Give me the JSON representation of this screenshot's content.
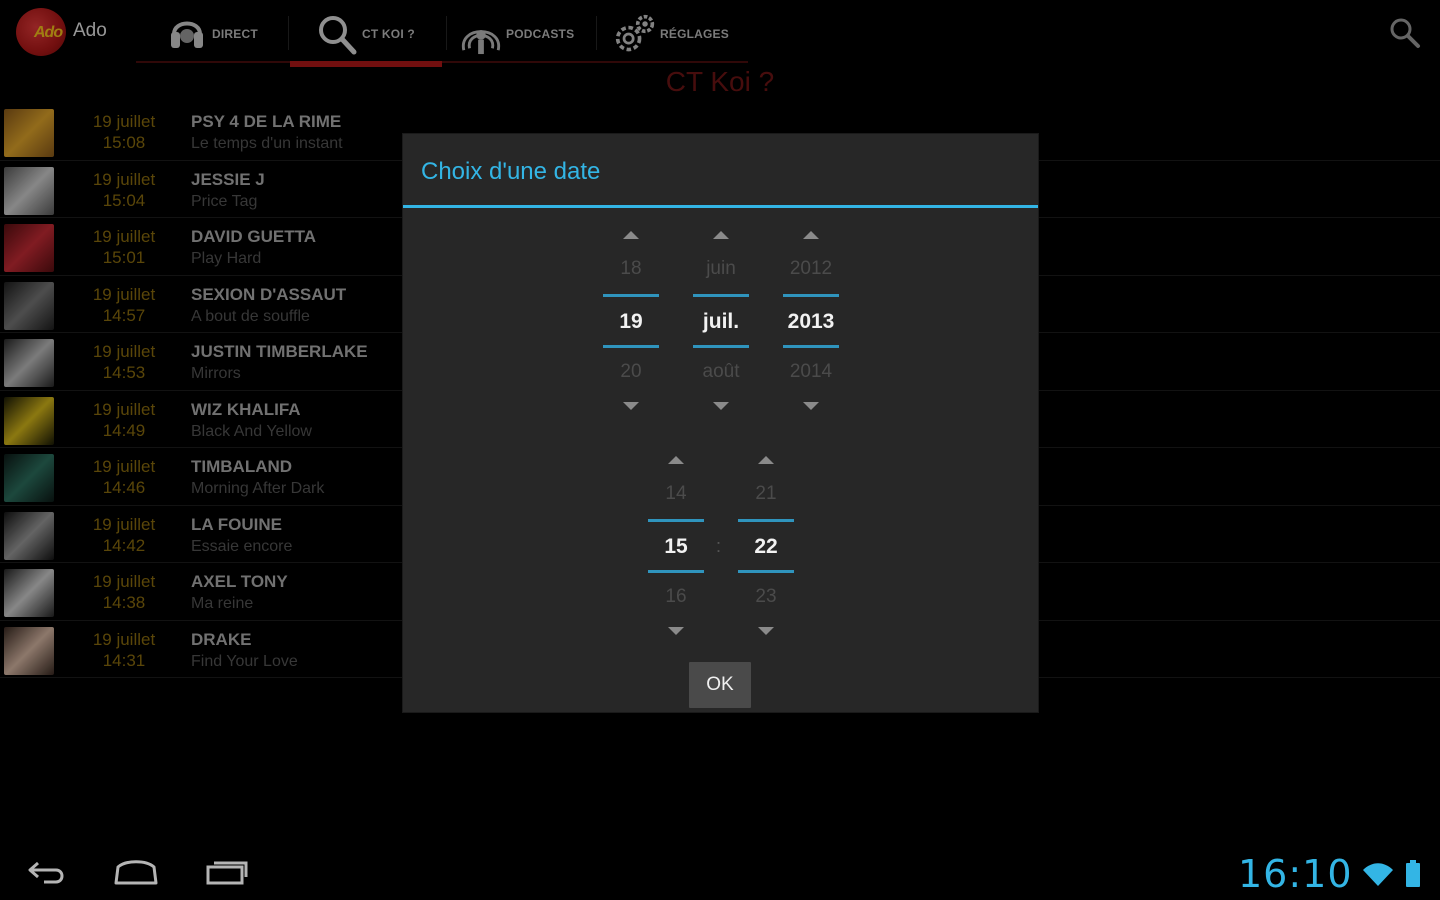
{
  "app": {
    "title": "Ado",
    "logo_text": "Ado"
  },
  "tabs": [
    {
      "label": "DIRECT",
      "icon": "headphones-icon"
    },
    {
      "label": "CT KOI ?",
      "icon": "search-icon"
    },
    {
      "label": "PODCASTS",
      "icon": "podcast-icon"
    },
    {
      "label": "RÉGLAGES",
      "icon": "gear-icon"
    }
  ],
  "section_title": "CT Koi ?",
  "tracks": [
    {
      "date": "19 juillet",
      "time": "15:08",
      "artist": "PSY 4 DE LA RIME",
      "song": "Le temps d'un instant",
      "thumb": [
        "#8a5a1a",
        "#e0a42a"
      ]
    },
    {
      "date": "19 juillet",
      "time": "15:04",
      "artist": "JESSIE J",
      "song": "Price Tag",
      "thumb": [
        "#5b5b5b",
        "#cfcfcf"
      ]
    },
    {
      "date": "19 juillet",
      "time": "15:01",
      "artist": "DAVID GUETTA",
      "song": "Play Hard",
      "thumb": [
        "#5a0f12",
        "#c62b35"
      ]
    },
    {
      "date": "19 juillet",
      "time": "14:57",
      "artist": "SEXION D'ASSAUT",
      "song": "A bout de souffle",
      "thumb": [
        "#1e1e1e",
        "#777777"
      ]
    },
    {
      "date": "19 juillet",
      "time": "14:53",
      "artist": "JUSTIN TIMBERLAKE",
      "song": "Mirrors",
      "thumb": [
        "#2a2a2a",
        "#bdbdbd"
      ]
    },
    {
      "date": "19 juillet",
      "time": "14:49",
      "artist": "WIZ KHALIFA",
      "song": "Black And Yellow",
      "thumb": [
        "#1a1a06",
        "#d6b81a"
      ]
    },
    {
      "date": "19 juillet",
      "time": "14:46",
      "artist": "TIMBALAND",
      "song": "Morning After Dark",
      "thumb": [
        "#0d1a17",
        "#2c6f5e"
      ]
    },
    {
      "date": "19 juillet",
      "time": "14:42",
      "artist": "LA FOUINE",
      "song": "Essaie encore",
      "thumb": [
        "#151515",
        "#9a9a9a"
      ]
    },
    {
      "date": "19 juillet",
      "time": "14:38",
      "artist": "AXEL TONY",
      "song": "Ma reine",
      "thumb": [
        "#262626",
        "#d0d0d0"
      ]
    },
    {
      "date": "19 juillet",
      "time": "14:31",
      "artist": "DRAKE",
      "song": "Find Your Love",
      "thumb": [
        "#3a2a22",
        "#d8b8a4"
      ]
    }
  ],
  "dialog": {
    "title": "Choix d'une date",
    "day": {
      "prev": "18",
      "current": "19",
      "next": "20"
    },
    "month": {
      "prev": "juin",
      "current": "juil.",
      "next": "août"
    },
    "year": {
      "prev": "2012",
      "current": "2013",
      "next": "2014"
    },
    "hour": {
      "prev": "14",
      "current": "15",
      "next": "16"
    },
    "minute": {
      "prev": "21",
      "current": "22",
      "next": "23"
    },
    "time_separator": ":",
    "ok_label": "OK"
  },
  "status": {
    "clock": "16:10"
  },
  "colors": {
    "accent": "#33b5e5",
    "brand_red": "#b01818",
    "date_gold": "#8a6c0e"
  }
}
